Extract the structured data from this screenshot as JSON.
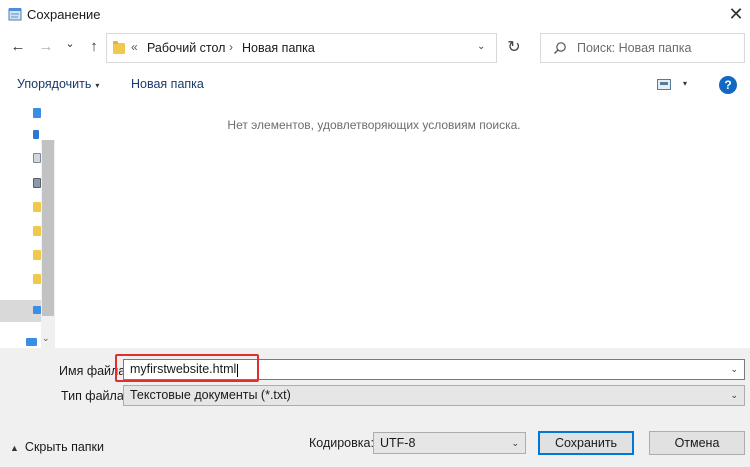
{
  "window": {
    "title": "Сохранение",
    "close_glyph": "✕"
  },
  "nav": {
    "back_glyph": "←",
    "forward_glyph": "→",
    "history_glyph": "⌄",
    "up_glyph": "↑",
    "breadcrumb_prefix": "«",
    "breadcrumb": [
      "Рабочий стол",
      "Новая папка"
    ],
    "breadcrumb_sep": "›",
    "address_dropdown_glyph": "⌄",
    "refresh_glyph": "↻",
    "search_placeholder": "Поиск: Новая папка"
  },
  "toolbar": {
    "organize_label": "Упорядочить",
    "organize_arrow": "▾",
    "new_folder_label": "Новая папка",
    "view_arrow": "▾",
    "help_glyph": "?"
  },
  "content": {
    "empty_message": "Нет элементов, удовлетворяющих условиям поиска."
  },
  "form": {
    "filename_label": "Имя файла:",
    "filename_value": "myfirstwebsite.html",
    "filetype_label": "Тип файла:",
    "filetype_value": "Текстовые документы (*.txt)",
    "dropdown_glyph": "⌄"
  },
  "footer": {
    "hide_folders_label": "Скрыть папки",
    "hide_folders_caret": "▲",
    "encoding_label": "Кодировка:",
    "encoding_value": "UTF-8",
    "save_label": "Сохранить",
    "cancel_label": "Отмена"
  },
  "colors": {
    "accent": "#0078d7",
    "highlight_border": "#e0302b",
    "help_icon": "#1368c4",
    "folder": "#f0c94c"
  },
  "icons": {
    "title": "notepad-icon",
    "search": "search-icon",
    "view": "view-options-icon",
    "help": "help-icon"
  }
}
